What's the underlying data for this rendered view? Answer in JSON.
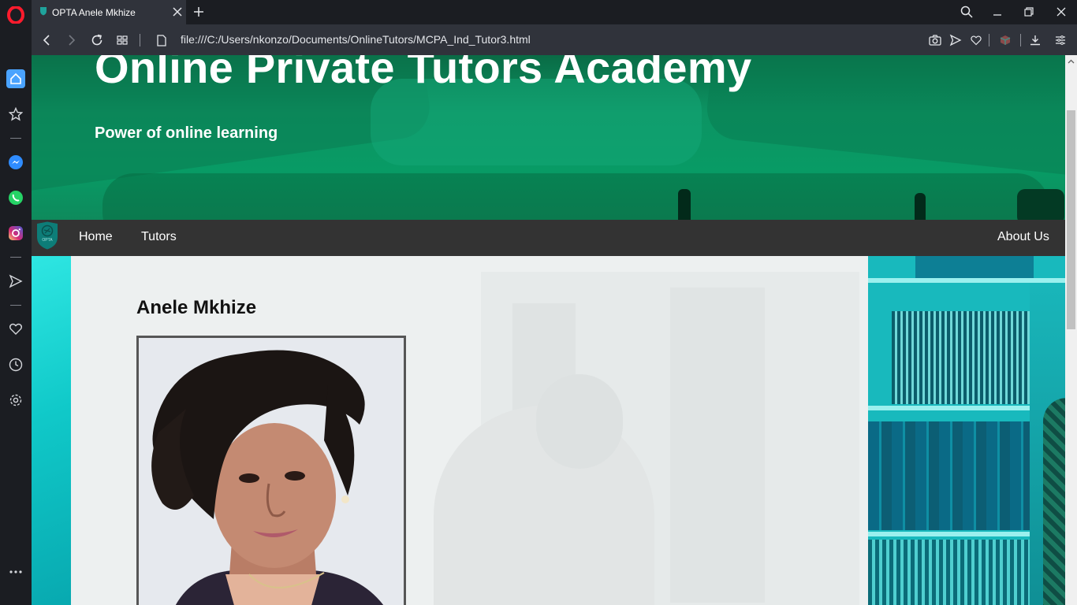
{
  "browser": {
    "tab_title": "OPTA Anele Mkhize",
    "url": "file:///C:/Users/nkonzo/Documents/OnlineTutors/MCPA_Ind_Tutor3.html"
  },
  "page": {
    "hero": {
      "title": "Online Private Tutors Academy",
      "subtitle": "Power of online learning"
    },
    "nav": {
      "logo_text": "OPTA",
      "items": [
        {
          "label": "Home"
        },
        {
          "label": "Tutors"
        }
      ],
      "right_item": {
        "label": "About Us"
      }
    },
    "tutor": {
      "name": "Anele Mkhize"
    }
  },
  "colors": {
    "hero_green": "#0c9463",
    "nav_bg": "#333333",
    "accent_teal": "#18b9bd",
    "browser_chrome": "#30333b"
  },
  "icons": [
    "opera-logo-icon",
    "home-icon",
    "star-icon",
    "messenger-icon",
    "whatsapp-icon",
    "instagram-icon",
    "send-icon",
    "heart-icon",
    "history-icon",
    "settings-icon",
    "more-icon",
    "shield-icon",
    "close-icon",
    "plus-icon",
    "search-icon",
    "minimize-icon",
    "restore-icon",
    "back-icon",
    "forward-icon",
    "reload-icon",
    "tabs-grid-icon",
    "page-icon",
    "camera-icon",
    "flow-icon",
    "download-icon",
    "menu-icon"
  ]
}
